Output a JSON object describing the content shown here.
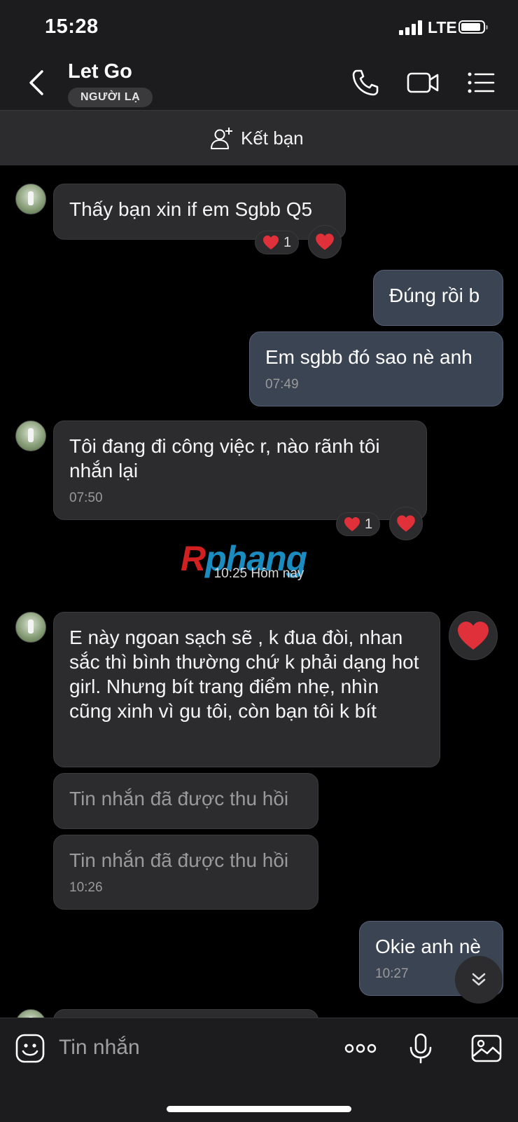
{
  "status": {
    "time": "15:28",
    "network": "LTE"
  },
  "header": {
    "title": "Let Go",
    "tag": "NGƯỜI LẠ"
  },
  "add_friend": {
    "label": "Kết bạn"
  },
  "messages": {
    "m1": {
      "text": "Thấy bạn xin if em Sgbb Q5",
      "reaction_count": "1"
    },
    "m2": {
      "text": "Đúng rồi b"
    },
    "m3": {
      "text": "Em sgbb đó sao nè anh",
      "time": "07:49"
    },
    "m4": {
      "text": "Tôi đang đi công việc r, nào rãnh tôi nhắn lại",
      "time": "07:50",
      "reaction_count": "1"
    },
    "m5": {
      "text": "E này ngoan sạch sẽ , k đua đòi, nhan sắc thì bình thường chứ k phải dạng hot girl. Nhưng bít trang điểm nhẹ, nhìn cũng xinh vì gu tôi, còn bạn tôi k bít"
    },
    "m6": {
      "text": "Tin nhắn đã được thu hồi"
    },
    "m7": {
      "text": "Tin nhắn đã được thu hồi",
      "time": "10:26"
    },
    "m8": {
      "text": "Okie anh nè",
      "time": "10:27"
    }
  },
  "divider": {
    "text": "10:25 Hôm nay"
  },
  "watermark": {
    "first": "R",
    "rest": "phang"
  },
  "composer": {
    "placeholder": "Tin nhắn"
  },
  "colors": {
    "background": "#000000",
    "incoming_bubble": "#2c2c2e",
    "outgoing_bubble": "#3b4453",
    "heart": "#e0303a"
  },
  "icons": [
    "back-icon",
    "phone-icon",
    "video-call-icon",
    "menu-list-icon",
    "add-friend-icon",
    "heart-icon",
    "scroll-down-icon",
    "sticker-icon",
    "more-icon",
    "microphone-icon",
    "image-icon"
  ]
}
